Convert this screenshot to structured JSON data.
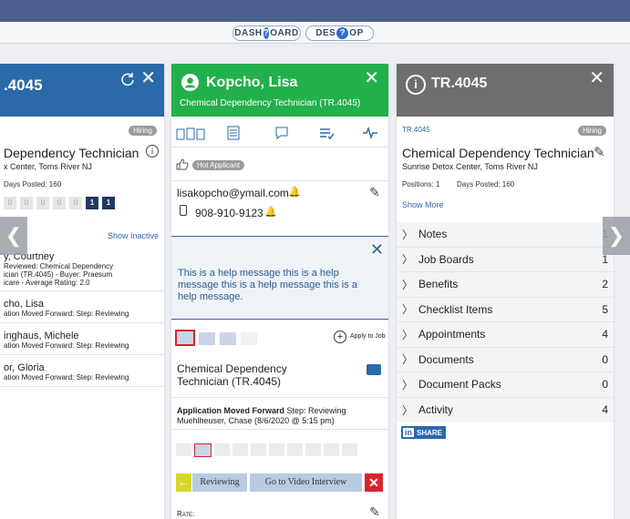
{
  "toolbar": {
    "dashboard": [
      "DASH",
      "OARD"
    ],
    "desktop": [
      "DES",
      "OP"
    ],
    "help_glyph": "?"
  },
  "left": {
    "title": ".4045",
    "badge": "Hiring",
    "job_title": "Dependency Technician",
    "location": "x Center, Toms River NJ",
    "days_posted": "Days Posted: 160",
    "pipeline_counts": [
      "0",
      "0",
      "0",
      "0",
      "0",
      "1",
      "1"
    ],
    "show_inactive": "Show Inactive",
    "candidates": [
      {
        "name": "y, Courtney",
        "line1": "Reviewed: Chemical Dependency",
        "line2": "ician (TR.4045) - Buyer: Praesum",
        "line3": "icare - Average Rating: 2.0"
      },
      {
        "name": "cho, Lisa",
        "line1": "ation Moved Forward: Step: Reviewing"
      },
      {
        "name": "inghaus, Michele",
        "line1": "ation Moved Forward: Step: Reviewing"
      },
      {
        "name": "or, Gloria",
        "line1": "ation Moved Forward: Step: Reviewing"
      }
    ]
  },
  "middle": {
    "name": "Kopcho, Lisa",
    "subtitle": "Chemical Dependency Technician (TR.4045)",
    "tag": "Hot Applicant",
    "email": "lisakopcho@ymail.com",
    "phone": "908-910-9123",
    "help_text": "This is a help message this is a help message this is a help message this is a help message.",
    "apply_to_job": "Apply to Job",
    "job": "Chemical Dependency Technician (TR.4045)",
    "activity_title": "Application Moved Forward",
    "activity_step": "Step: Reviewing",
    "activity_by": "Muehlheuser, Chase (8/6/2020 @ 5:15 pm)",
    "btn_reviewing": "Reviewing",
    "btn_video": "Go to Video Interview",
    "rate_label": "Rate:",
    "colors": {
      "accent": "#22b04a",
      "danger": "#d9232e",
      "yellow": "#d6d62a"
    }
  },
  "right": {
    "title": "TR.4045",
    "code": "TR.4045",
    "badge": "Hiring",
    "job_title": "Chemical Dependency Technician",
    "location": "Sunrise Detox Center, Toms River NJ",
    "positions": "Positions: 1",
    "days_posted": "Days Posted: 160",
    "show_more": "Show More",
    "sections": [
      {
        "label": "Notes",
        "count": "1"
      },
      {
        "label": "Job Boards",
        "count": "1"
      },
      {
        "label": "Benefits",
        "count": "2"
      },
      {
        "label": "Checklist Items",
        "count": "5"
      },
      {
        "label": "Appointments",
        "count": "4"
      },
      {
        "label": "Documents",
        "count": "0"
      },
      {
        "label": "Document Packs",
        "count": "0"
      },
      {
        "label": "Activity",
        "count": "4"
      }
    ],
    "share": "SHARE",
    "share_brand": "in"
  }
}
